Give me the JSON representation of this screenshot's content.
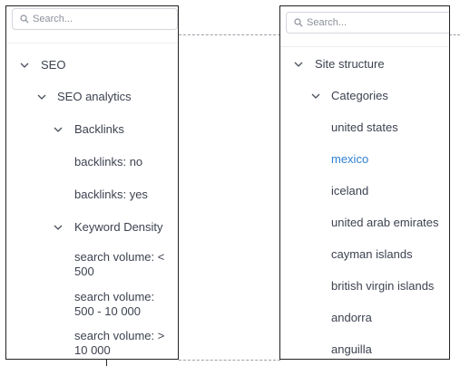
{
  "left_panel": {
    "search_placeholder": "Search...",
    "tree": [
      {
        "label": "SEO",
        "expandable": true
      },
      {
        "label": "SEO analytics",
        "expandable": true
      },
      {
        "label": "Backlinks",
        "expandable": true
      },
      {
        "label": "backlinks: no",
        "expandable": false
      },
      {
        "label": "backlinks: yes",
        "expandable": false
      },
      {
        "label": "Keyword Density",
        "expandable": true
      },
      {
        "label": "search volume: < 500",
        "expandable": false
      },
      {
        "label": "search volume: 500 - 10 000",
        "expandable": false
      },
      {
        "label": "search volume: > 10 000",
        "expandable": false
      }
    ]
  },
  "right_panel": {
    "search_placeholder": "Search...",
    "tree": [
      {
        "label": "Site structure",
        "expandable": true
      },
      {
        "label": "Categories",
        "expandable": true
      },
      {
        "label": "united states",
        "expandable": false
      },
      {
        "label": "mexico",
        "expandable": false,
        "selected": true
      },
      {
        "label": "iceland",
        "expandable": false
      },
      {
        "label": "united arab emirates",
        "expandable": false
      },
      {
        "label": "cayman islands",
        "expandable": false
      },
      {
        "label": "british virgin islands",
        "expandable": false
      },
      {
        "label": "andorra",
        "expandable": false
      },
      {
        "label": "anguilla",
        "expandable": false
      }
    ]
  },
  "colors": {
    "text": "#3d4250",
    "selected": "#2f80d1",
    "placeholder": "#8b909a"
  }
}
